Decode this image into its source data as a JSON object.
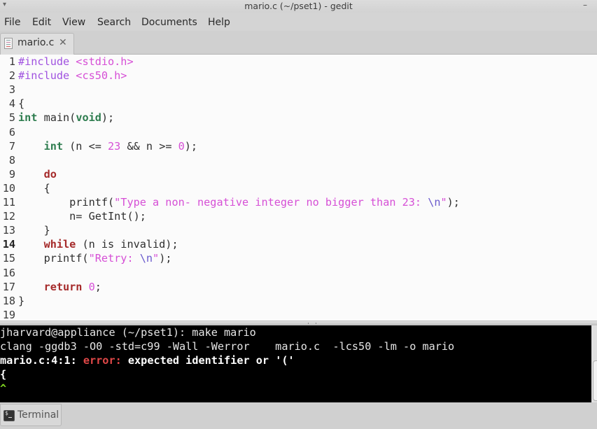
{
  "window": {
    "title": "mario.c (~/pset1) - gedit",
    "menu_arrow": "▾",
    "minimize": "–",
    "maximize": "▫"
  },
  "menubar": {
    "items": [
      "File",
      "Edit",
      "View",
      "Search",
      "Documents",
      "Help"
    ]
  },
  "tabs": [
    {
      "label": "mario.c",
      "close": "✕",
      "icon": "text-file-icon"
    }
  ],
  "editor": {
    "current_line": 14,
    "lines": [
      {
        "n": "1",
        "tokens": [
          {
            "c": "kw-pp",
            "t": "#include "
          },
          {
            "c": "str",
            "t": "<stdio.h>"
          }
        ]
      },
      {
        "n": "2",
        "tokens": [
          {
            "c": "kw-pp",
            "t": "#include "
          },
          {
            "c": "str",
            "t": "<cs50.h>"
          }
        ]
      },
      {
        "n": "3",
        "tokens": []
      },
      {
        "n": "4",
        "tokens": [
          {
            "c": "",
            "t": "{"
          }
        ]
      },
      {
        "n": "5",
        "tokens": [
          {
            "c": "type",
            "t": "int"
          },
          {
            "c": "",
            "t": " main("
          },
          {
            "c": "type",
            "t": "void"
          },
          {
            "c": "",
            "t": ");"
          }
        ]
      },
      {
        "n": "6",
        "tokens": []
      },
      {
        "n": "7",
        "tokens": [
          {
            "c": "",
            "t": "    "
          },
          {
            "c": "type",
            "t": "int"
          },
          {
            "c": "",
            "t": " (n <= "
          },
          {
            "c": "num",
            "t": "23"
          },
          {
            "c": "",
            "t": " && n >= "
          },
          {
            "c": "num",
            "t": "0"
          },
          {
            "c": "",
            "t": ");"
          }
        ]
      },
      {
        "n": "8",
        "tokens": []
      },
      {
        "n": "9",
        "tokens": [
          {
            "c": "",
            "t": "    "
          },
          {
            "c": "ctl",
            "t": "do"
          }
        ]
      },
      {
        "n": "10",
        "tokens": [
          {
            "c": "",
            "t": "    {"
          }
        ]
      },
      {
        "n": "11",
        "tokens": [
          {
            "c": "",
            "t": "        printf("
          },
          {
            "c": "str",
            "t": "\"Type a non- negative integer no bigger than 23: "
          },
          {
            "c": "esc",
            "t": "\\n"
          },
          {
            "c": "str",
            "t": "\""
          },
          {
            "c": "",
            "t": ");"
          }
        ]
      },
      {
        "n": "12",
        "tokens": [
          {
            "c": "",
            "t": "        n= GetInt();"
          }
        ]
      },
      {
        "n": "13",
        "tokens": [
          {
            "c": "",
            "t": "    }"
          }
        ]
      },
      {
        "n": "14",
        "tokens": [
          {
            "c": "",
            "t": "    "
          },
          {
            "c": "ctl",
            "t": "while"
          },
          {
            "c": "",
            "t": " (n is invalid);"
          }
        ]
      },
      {
        "n": "15",
        "tokens": [
          {
            "c": "",
            "t": "    printf("
          },
          {
            "c": "str",
            "t": "\"Retry: "
          },
          {
            "c": "esc",
            "t": "\\n"
          },
          {
            "c": "str",
            "t": "\""
          },
          {
            "c": "",
            "t": ");"
          }
        ]
      },
      {
        "n": "16",
        "tokens": []
      },
      {
        "n": "17",
        "tokens": [
          {
            "c": "",
            "t": "    "
          },
          {
            "c": "ctl",
            "t": "return"
          },
          {
            "c": "",
            "t": " "
          },
          {
            "c": "num",
            "t": "0"
          },
          {
            "c": "",
            "t": ";"
          }
        ]
      },
      {
        "n": "18",
        "tokens": [
          {
            "c": "",
            "t": "}"
          }
        ]
      },
      {
        "n": "19",
        "tokens": []
      }
    ]
  },
  "terminal": {
    "lines": [
      [
        {
          "c": "",
          "t": "jharvard@appliance (~/pset1): make mario"
        }
      ],
      [
        {
          "c": "",
          "t": "clang -ggdb3 -O0 -std=c99 -Wall -Werror    mario.c  -lcs50 -lm -o mario"
        }
      ],
      [
        {
          "c": "b",
          "t": "mario.c:4:1: "
        },
        {
          "c": "err",
          "t": "error: "
        },
        {
          "c": "b",
          "t": "expected identifier or '('"
        }
      ],
      [
        {
          "c": "b",
          "t": "{"
        }
      ],
      [
        {
          "c": "caret",
          "t": "^"
        }
      ]
    ]
  },
  "bottom_panel": {
    "tab_label": "Terminal"
  },
  "colors": {
    "preprocessor": "#a052e0",
    "string": "#d64fd6",
    "type": "#2e7d4f",
    "control": "#a52a2a",
    "error": "#e04848",
    "caret": "#7ed321",
    "terminal_bg": "#000000",
    "editor_bg": "#fbfbfb"
  }
}
